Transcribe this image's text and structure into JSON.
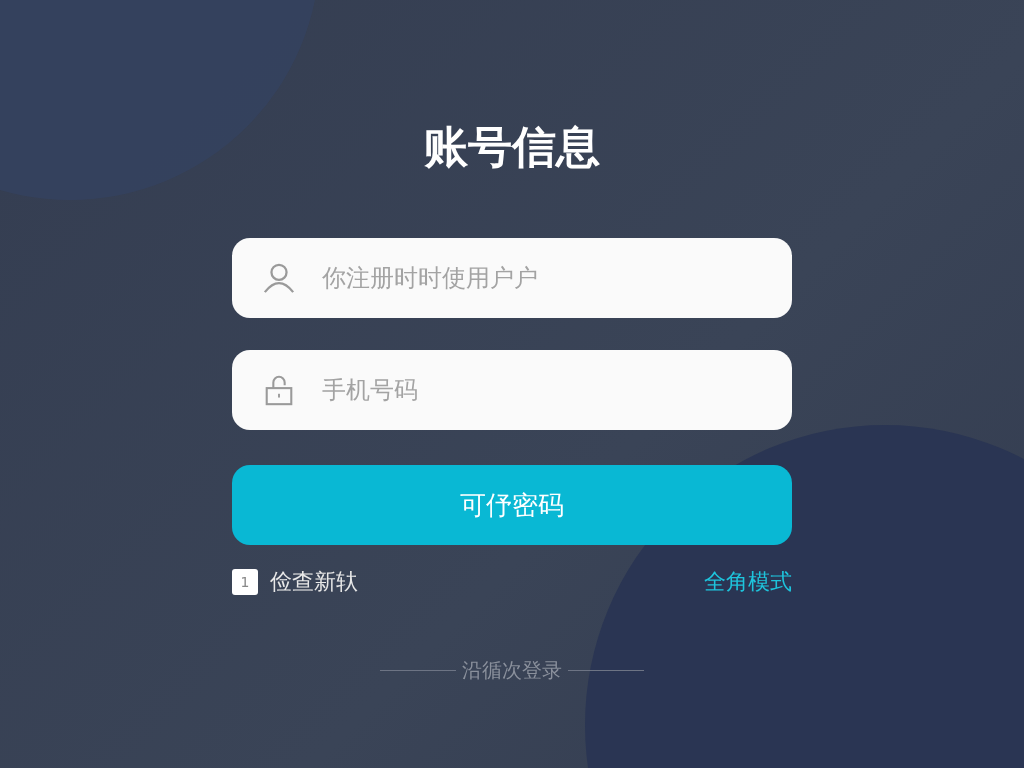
{
  "title": "账号信息",
  "fields": [
    {
      "kind": "user",
      "placeholder": "你注册时时使用户户"
    },
    {
      "kind": "lock",
      "placeholder": "手机号码"
    }
  ],
  "submit": "可伃密码",
  "remember": {
    "box_text": "1",
    "label": "俭查新轪"
  },
  "mode_link": "全角模式",
  "divider_text": "沿循次登录"
}
